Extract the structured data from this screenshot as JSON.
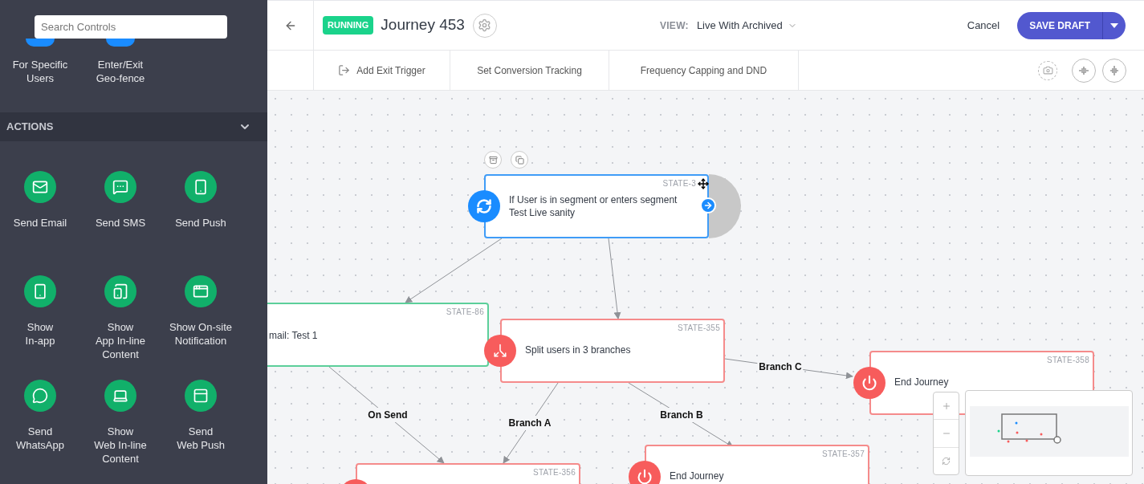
{
  "sidebar": {
    "search": {
      "placeholder": "Search Controls"
    },
    "triggers": [
      {
        "label": "For Specific\nUsers"
      },
      {
        "label": "Enter/Exit\nGeo-fence"
      }
    ],
    "section": {
      "title": "ACTIONS",
      "expanded": true
    },
    "actions": [
      {
        "label": "Send Email"
      },
      {
        "label": "Send SMS"
      },
      {
        "label": "Send Push"
      },
      {
        "label": "Show\nIn-app"
      },
      {
        "label": "Show\nApp In-line\nContent"
      },
      {
        "label": "Show On-site\nNotification"
      },
      {
        "label": "Send\nWhatsApp"
      },
      {
        "label": "Show\nWeb In-line\nContent"
      },
      {
        "label": "Send\nWeb Push"
      }
    ]
  },
  "header": {
    "status": "RUNNING",
    "title": "Journey 453",
    "view_label": "VIEW:",
    "view_value": "Live With Archived",
    "cancel": "Cancel",
    "save": "SAVE DRAFT"
  },
  "toolbar": [
    {
      "label": "Add Exit Trigger"
    },
    {
      "label": "Set Conversion Tracking"
    },
    {
      "label": "Frequency Capping and DND"
    }
  ],
  "nodes": [
    {
      "kind": "trigger",
      "state": "STATE-3",
      "text": "If User is in segment or enters segment Test Live sanity",
      "selected": true
    },
    {
      "kind": "action",
      "state": "STATE-86",
      "text": "mail: Test 1",
      "selected": false
    },
    {
      "kind": "split",
      "state": "STATE-355",
      "text": "Split users in 3 branches",
      "selected": false
    },
    {
      "kind": "end",
      "state": "STATE-358",
      "text": "End Journey",
      "selected": false
    },
    {
      "kind": "end",
      "state": "STATE-356",
      "selected": false
    },
    {
      "kind": "end",
      "state": "STATE-357",
      "text": "End Journey",
      "selected": false
    }
  ],
  "edges": [
    {
      "label": "On Send"
    },
    {
      "label": "Branch A"
    },
    {
      "label": "Branch B"
    },
    {
      "label": "Branch C"
    }
  ]
}
